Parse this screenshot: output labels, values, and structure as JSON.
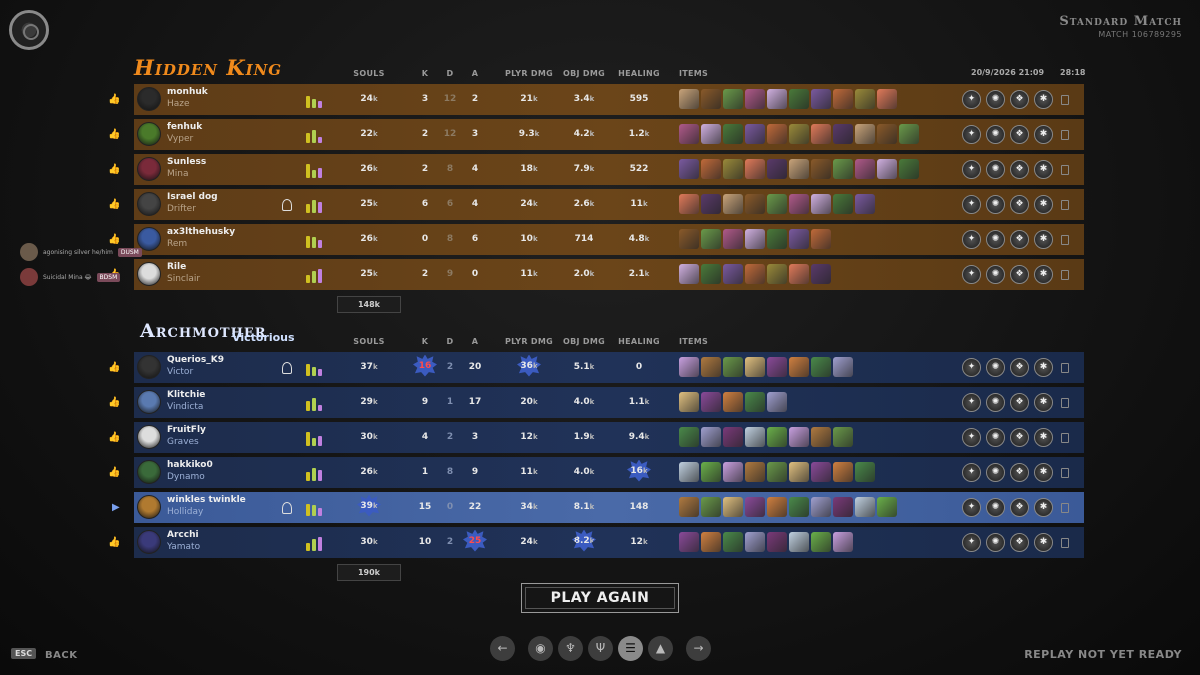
{
  "header": {
    "mode": "Standard Match",
    "match_id": "MATCH 106789295",
    "datetime": "20/9/2026 21:09",
    "duration": "28:18"
  },
  "columns": {
    "souls": "SOULS",
    "k": "K",
    "d": "D",
    "a": "A",
    "plyr_dmg": "PLYR DMG",
    "obj_dmg": "OBJ DMG",
    "healing": "HEALING",
    "items": "ITEMS"
  },
  "hidden_king": {
    "name": "Hidden King",
    "total_souls": "148k",
    "players": [
      {
        "name": "monhuk",
        "hero": "Haze",
        "souls": "24",
        "k": "3",
        "d": "12",
        "a": "2",
        "plyr": "21",
        "obj": "3.4",
        "heal": "595",
        "avatar": "#2b2b2b"
      },
      {
        "name": "fenhuk",
        "hero": "Vyper",
        "souls": "22",
        "k": "2",
        "d": "12",
        "a": "3",
        "plyr": "9.3",
        "obj": "4.2",
        "heal": "1.2",
        "avatar": "#4a7a2a"
      },
      {
        "name": "Sunless",
        "hero": "Mina",
        "souls": "26",
        "k": "2",
        "d": "8",
        "a": "4",
        "plyr": "18",
        "obj": "7.9",
        "heal": "522",
        "avatar": "#7a2a3a"
      },
      {
        "name": "Israel dog",
        "hero": "Drifter",
        "souls": "25",
        "k": "6",
        "d": "6",
        "a": "4",
        "plyr": "24",
        "obj": "2.6",
        "heal": "11",
        "avatar": "#444"
      },
      {
        "name": "ax3lthehusky",
        "hero": "Rem",
        "souls": "26",
        "k": "0",
        "d": "8",
        "a": "6",
        "plyr": "10",
        "obj": "714",
        "heal": "4.8",
        "avatar": "#3a5aa0"
      },
      {
        "name": "Rile",
        "hero": "Sinclair",
        "souls": "25",
        "k": "2",
        "d": "9",
        "a": "0",
        "plyr": "11",
        "obj": "2.0",
        "heal": "2.1",
        "avatar": "#dcdcdc"
      }
    ]
  },
  "archmother": {
    "name": "Archmother",
    "status": "Victorious",
    "total_souls": "190k",
    "players": [
      {
        "name": "Querios_K9",
        "hero": "Victor",
        "souls": "37",
        "k": "16",
        "d": "2",
        "a": "20",
        "plyr": "36",
        "obj": "5.1",
        "heal": "0",
        "avatar": "#333"
      },
      {
        "name": "Klitchie",
        "hero": "Vindicta",
        "souls": "29",
        "k": "9",
        "d": "1",
        "a": "17",
        "plyr": "20",
        "obj": "4.0",
        "heal": "1.1",
        "avatar": "#5a7ab0"
      },
      {
        "name": "FruitFly",
        "hero": "Graves",
        "souls": "30",
        "k": "4",
        "d": "2",
        "a": "3",
        "plyr": "12",
        "obj": "1.9",
        "heal": "9.4",
        "avatar": "#ddd"
      },
      {
        "name": "hakkiko0",
        "hero": "Dynamo",
        "souls": "26",
        "k": "1",
        "d": "8",
        "a": "9",
        "plyr": "11",
        "obj": "4.0",
        "heal": "16",
        "avatar": "#3a6a3a"
      },
      {
        "name": "winkles twinkle",
        "hero": "Holliday",
        "souls": "39",
        "k": "15",
        "d": "0",
        "a": "22",
        "plyr": "34",
        "obj": "8.1",
        "heal": "148",
        "avatar": "#b07a30"
      },
      {
        "name": "Arcchi",
        "hero": "Yamato",
        "souls": "30",
        "k": "10",
        "d": "2",
        "a": "25",
        "plyr": "24",
        "obj": "8.2",
        "heal": "12",
        "avatar": "#3a3a7a"
      }
    ]
  },
  "chat": [
    {
      "text": "agonising silver he/him",
      "tag": "DUSM"
    },
    {
      "text": "Suicidal Mina 😂",
      "tag": "BDSM"
    }
  ],
  "buttons": {
    "play_again": "PLAY AGAIN",
    "esc": "ESC",
    "back": "BACK",
    "replay": "REPLAY NOT YET READY"
  },
  "unit_k": "k",
  "colors": {
    "hidden_king": "#f08a1c",
    "archmother_row": "#203258",
    "selected_row": "#4a6aa8"
  }
}
